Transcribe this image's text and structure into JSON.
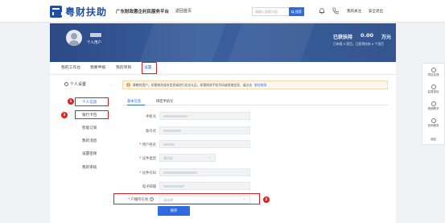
{
  "header": {
    "logo_text": "粤财扶助",
    "platform": "广东财政惠企利民服务平台",
    "home": "返回首页",
    "search_placeholder": "请输入搜索内容",
    "search_button": "搜索",
    "my_follow": "我的关注",
    "logout": "安全退出"
  },
  "banner": {
    "user_type": "个人用户",
    "support_label": "已获扶持",
    "support_amount": "0.00",
    "support_unit": "万元",
    "support_sub": "已申报 0 项目，已获得扶持 0 个项目"
  },
  "tabs": [
    {
      "label": "我的工作台"
    },
    {
      "label": "我要申报"
    },
    {
      "label": "我的项目"
    },
    {
      "label": "设置"
    }
  ],
  "sidebar": {
    "header": "个人设置",
    "items": [
      {
        "label": "个人信息"
      },
      {
        "label": "银行卡包"
      },
      {
        "label": "智能订阅"
      },
      {
        "label": "我的消息"
      },
      {
        "label": "设置密保"
      },
      {
        "label": "我的审核"
      }
    ]
  },
  "badges": [
    "1",
    "2",
    "3"
  ],
  "notice": {
    "text": "尊敬的用户，如需修改身份信息请进行实名认证，如需修改手机号码或其他信息，请点击",
    "link": "前往修改"
  },
  "subtabs": [
    {
      "label": "基本信息"
    },
    {
      "label": "绑定手机号"
    }
  ],
  "form": {
    "fields": [
      {
        "label": "手机号"
      },
      {
        "label": "账号名"
      },
      {
        "label": "用户姓名",
        "required": "*"
      },
      {
        "label": "证件类型",
        "required": "*",
        "value": "身份证"
      },
      {
        "label": "证件号码",
        "required": "*"
      },
      {
        "label": "电子邮箱"
      },
      {
        "label": "户籍所在地",
        "required": "*",
        "placeholder": "请选择"
      }
    ],
    "save_label": "保存"
  },
  "float_tools": [
    {
      "label": "项目反馈"
    },
    {
      "label": "监督投诉"
    },
    {
      "label": "视频教学"
    },
    {
      "label": "咨询服务"
    },
    {
      "label": "收起"
    }
  ]
}
